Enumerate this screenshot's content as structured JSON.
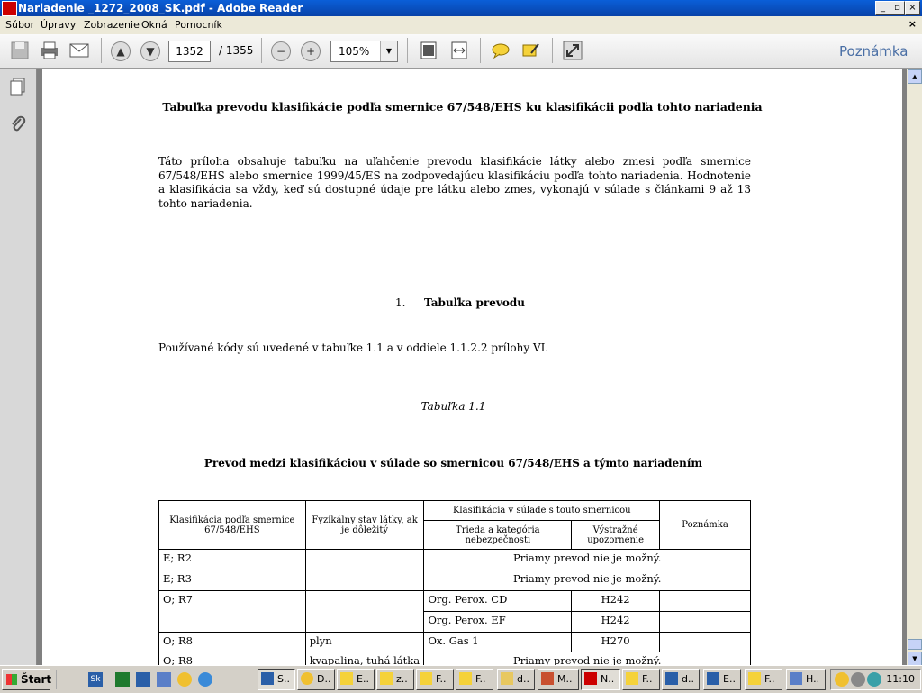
{
  "window": {
    "title": "Nariadenie _1272_2008_SK.pdf - Adobe Reader"
  },
  "menu": [
    "Súbor",
    "Úpravy",
    "Zobrazenie",
    "Okná",
    "Pomocník"
  ],
  "toolbar": {
    "current_page": "1352",
    "total_pages": "/ 1355",
    "zoom": "105%",
    "comment_label": "Poznámka"
  },
  "document": {
    "heading": "Tabuľka prevodu klasifikácie podľa smernice 67/548/EHS ku klasifikácii podľa tohto nariadenia",
    "intro": "Táto príloha obsahuje tabuľku na uľahčenie prevodu klasifikácie látky alebo zmesi podľa smernice 67/548/EHS alebo smernice 1999/45/ES na zodpovedajúcu klasifikáciu podľa tohto nariadenia. Hodnotenie a klasifikácia sa vždy, keď sú dostupné údaje pre látku alebo zmes, vykonajú v súlade s článkami 9 až 13 tohto nariadenia.",
    "section_num": "1.",
    "section_title": "Tabuľka prevodu",
    "codes_note": "Používané kódy sú uvedené v tabuľke 1.1 a v oddiele 1.1.2.2 prílohy VI.",
    "table_caption": "Tabuľka 1.1",
    "table_title": "Prevod medzi klasifikáciou v súlade so smernicou 67/548/EHS a týmto nariadením",
    "table": {
      "h_col1": "Klasifikácia podľa smernice 67/548/EHS",
      "h_col2": "Fyzikálny stav látky, ak je dôležitý",
      "h_group": "Klasifikácia v súlade s touto smernicou",
      "h_col3": "Trieda a kategória nebezpečnosti",
      "h_col4": "Výstražné upozornenie",
      "h_col5": "Poznámka",
      "rows": {
        "r1": {
          "c1": "E; R2",
          "merged": "Priamy prevod nie je možný."
        },
        "r2": {
          "c1": "E; R3",
          "merged": "Priamy prevod nie je možný."
        },
        "r3": {
          "c1": "O; R7",
          "c3a": "Org. Perox. CD",
          "c4a": "H242",
          "c3b": "Org. Perox. EF",
          "c4b": "H242"
        },
        "r4": {
          "c1": "O; R8",
          "c2": "plyn",
          "c3": "Ox. Gas 1",
          "c4": "H270"
        },
        "r5": {
          "c1": "O; R8",
          "c2": "kvapalina, tuhá látka",
          "merged": "Priamy prevod nie je možný."
        }
      }
    }
  },
  "taskbar": {
    "start": "Štart",
    "tasks": [
      "S..",
      "D..",
      "E..",
      "z..",
      "F..",
      "F..",
      "d..",
      "M..",
      "N..",
      "F..",
      "d..",
      "E..",
      "F..",
      "H.."
    ],
    "clock": "11:10"
  },
  "colors": {
    "titlebar": "#0a5fd8",
    "accent": "#4a6fa5",
    "pdf_red": "#cc0000"
  }
}
